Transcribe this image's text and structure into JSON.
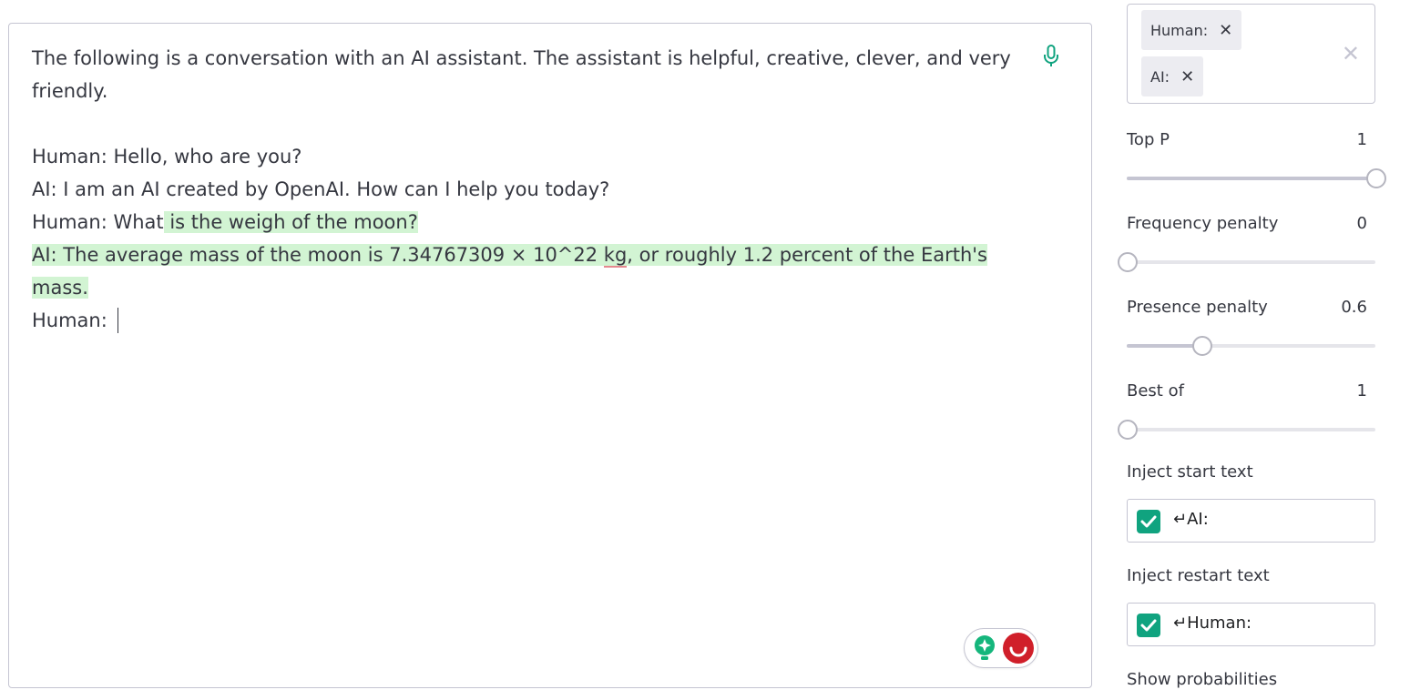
{
  "editor": {
    "lines": [
      {
        "pre": "The following is a conversation with an AI assistant. The assistant is helpful, creative, clever, and very friendly.",
        "hl": "",
        "squig": "",
        "post": ""
      },
      {
        "pre": "",
        "hl": "",
        "squig": "",
        "post": ""
      },
      {
        "pre": "Human: Hello, who are you?",
        "hl": "",
        "squig": "",
        "post": ""
      },
      {
        "pre": "AI: I am an AI created by OpenAI. How can I help you today?",
        "hl": "",
        "squig": "",
        "post": ""
      },
      {
        "pre": "Human: What",
        "hl": " is the weigh of the moon?",
        "squig": "",
        "post": ""
      },
      {
        "pre": "",
        "hl": "AI: The average mass of the moon is 7.34767309 × 10^22 ",
        "squig": "kg",
        "post": ", or roughly 1.2 percent of the Earth's mass."
      },
      {
        "pre": "Human: ",
        "hl": "",
        "squig": "",
        "post": "",
        "caret": true
      }
    ],
    "mic_icon": "microphone-icon",
    "helper_icons": [
      "grammar-bulb-icon",
      "extension-badge-icon"
    ]
  },
  "stop_sequences": {
    "chips": [
      "Human:",
      "AI:"
    ],
    "chip_remove_icon": "close-icon",
    "clear_icon": "clear-all-icon"
  },
  "params": [
    {
      "label": "Top P",
      "value": "1",
      "level": 1.0
    },
    {
      "label": "Frequency penalty",
      "value": "0",
      "level": 0.0
    },
    {
      "label": "Presence penalty",
      "value": "0.6",
      "level": 0.3
    },
    {
      "label": "Best of",
      "value": "1",
      "level": 0.0
    }
  ],
  "inject_start": {
    "label": "Inject start text",
    "text": "↵AI:",
    "checked": true
  },
  "inject_restart": {
    "label": "Inject restart text",
    "text": "↵Human:",
    "checked": true
  },
  "show_probabilities": {
    "label": "Show probabilities"
  },
  "colors": {
    "accent": "#10a37f",
    "highlight": "#d2f4d3",
    "border": "#c5c5d2"
  }
}
